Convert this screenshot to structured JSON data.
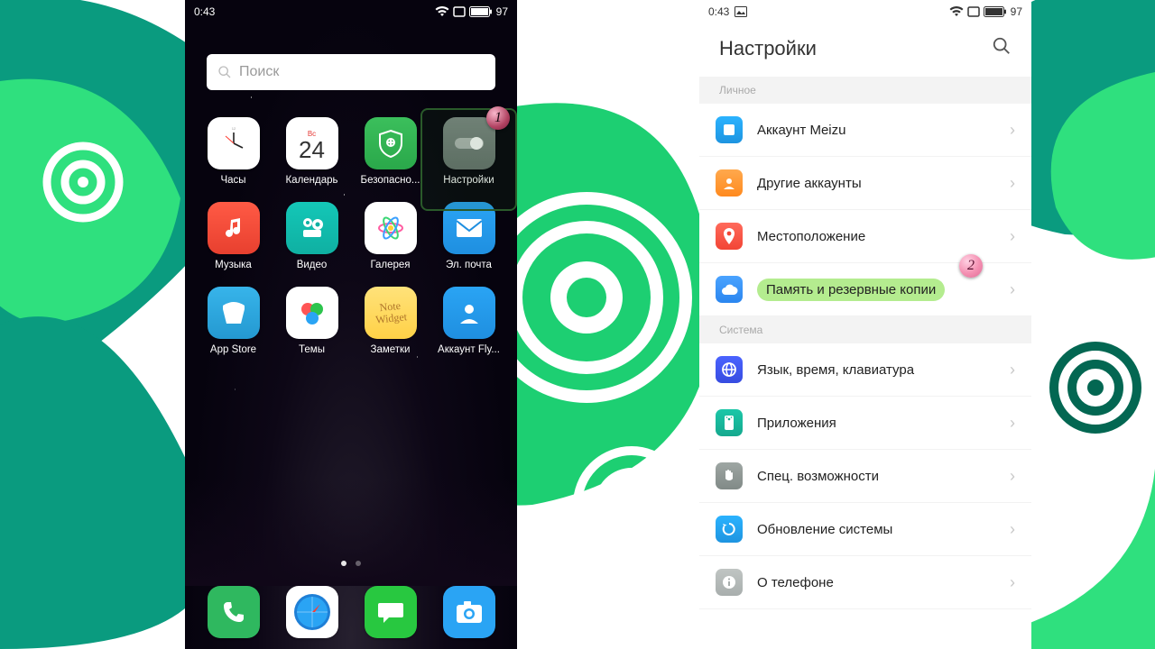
{
  "status": {
    "time": "0:43",
    "battery": "97"
  },
  "annotations": {
    "one": "1",
    "two": "2"
  },
  "home": {
    "search_placeholder": "Поиск",
    "apps": [
      {
        "label": "Часы"
      },
      {
        "label": "Календарь",
        "cal_day": "24",
        "cal_wd": "Вс"
      },
      {
        "label": "Безопасно..."
      },
      {
        "label": "Настройки"
      },
      {
        "label": "Музыка"
      },
      {
        "label": "Видео"
      },
      {
        "label": "Галерея"
      },
      {
        "label": "Эл. почта"
      },
      {
        "label": "App Store"
      },
      {
        "label": "Темы"
      },
      {
        "label": "Заметки",
        "note": "Note Widget"
      },
      {
        "label": "Аккаунт Fly..."
      }
    ]
  },
  "settings": {
    "title": "Настройки",
    "sections": {
      "personal": "Личное",
      "system": "Система"
    },
    "rows": {
      "meizu": "Аккаунт Meizu",
      "others": "Другие аккаунты",
      "location": "Местоположение",
      "storage": "Память и резервные копии",
      "lang": "Язык, время, клавиатура",
      "apps": "Приложения",
      "access": "Спец. возможности",
      "update": "Обновление системы",
      "about": "О телефоне"
    }
  }
}
